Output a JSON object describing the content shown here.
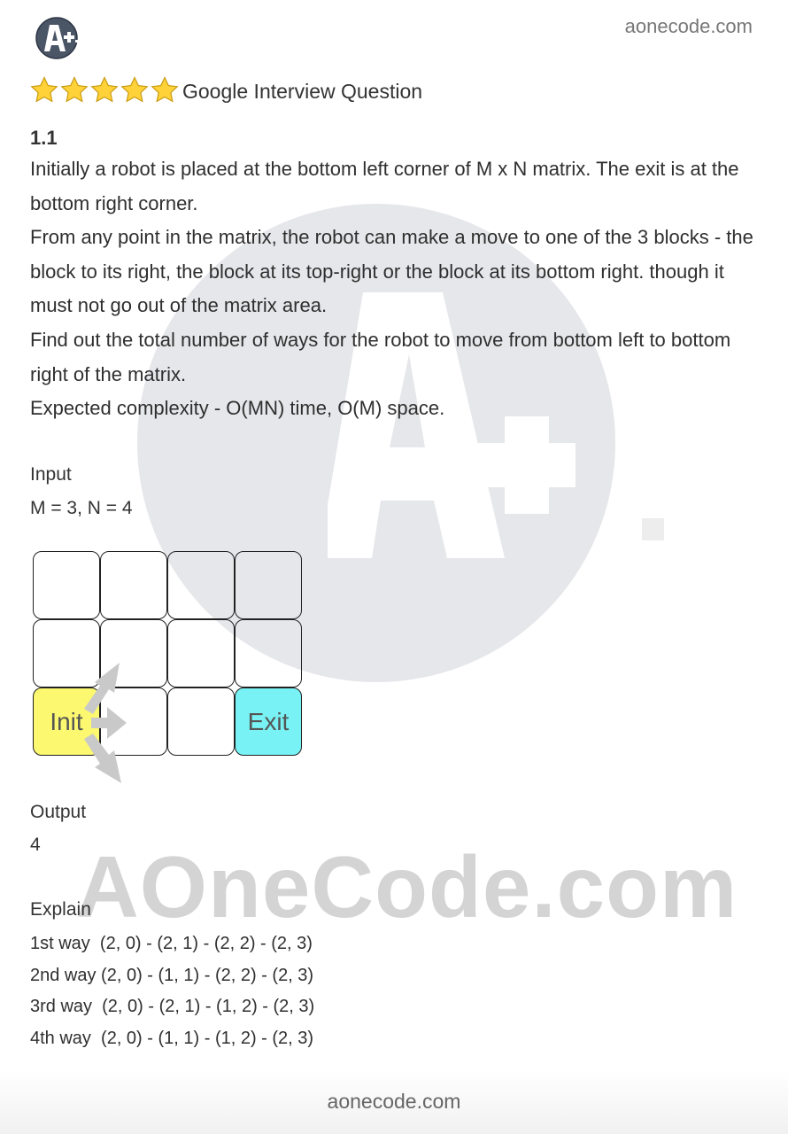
{
  "header": {
    "logo_text": "A++",
    "site": "aonecode.com",
    "star_count": 5,
    "title": "Google Interview Question"
  },
  "question": {
    "number": "1.1",
    "paragraphs": [
      "Initially a robot is placed at the bottom left corner of M x N matrix. The exit is at the bottom right corner.",
      "From any point in the matrix, the robot can make a move to one of the 3 blocks - the block to its right, the block at its top-right or the block at its bottom right. though it must not go out of the matrix area.",
      "Find out the total number of ways for the robot to move from bottom left to bottom right of the matrix.",
      "Expected complexity - O(MN) time, O(M) space."
    ]
  },
  "example": {
    "input_label": "Input",
    "input_value": "M = 3, N = 4",
    "grid": {
      "rows": 3,
      "cols": 4,
      "init_label": "Init",
      "exit_label": "Exit",
      "init_color": "#fcf870",
      "exit_color": "#78f2f4"
    },
    "output_label": "Output",
    "output_value": "4",
    "explain_label": "Explain",
    "ways": [
      "1st way  (2, 0) - (2, 1) - (2, 2) - (2, 3)",
      "2nd way (2, 0) - (1, 1) - (2, 2) - (2, 3)",
      "3rd way  (2, 0) - (2, 1) - (1, 2) - (2, 3)",
      "4th way  (2, 0) - (1, 1) - (1, 2) - (2, 3)"
    ]
  },
  "watermark": {
    "text": "AOneCode.com"
  },
  "footer": {
    "site": "aonecode.com"
  }
}
